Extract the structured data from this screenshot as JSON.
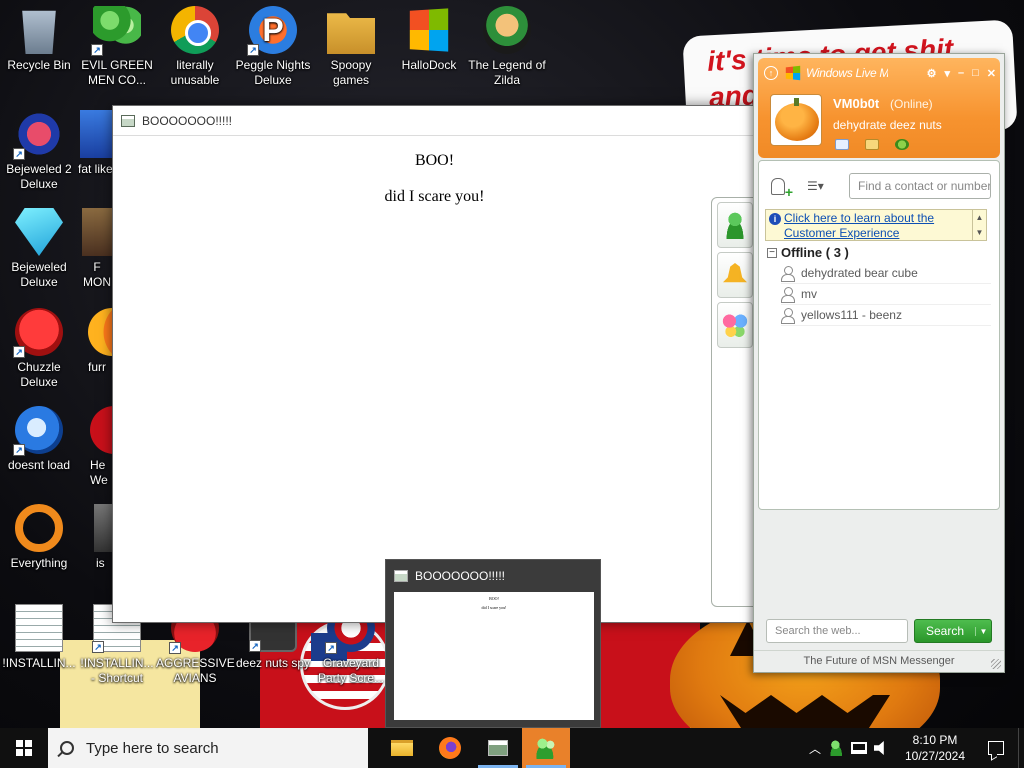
{
  "wallpaper": {
    "sign_line1": "it's time to get shit",
    "sign_line2": "and"
  },
  "desktop_icons": [
    {
      "label": "Recycle Bin",
      "icon": "recycle-bin-icon"
    },
    {
      "label": "EVIL GREEN MEN CO...",
      "icon": "msn-messenger-icon"
    },
    {
      "label": "literally unusable",
      "icon": "chrome-icon"
    },
    {
      "label": "Peggle Nights Deluxe",
      "icon": "peggle-icon"
    },
    {
      "label": "Spoopy games",
      "icon": "folder-icon"
    },
    {
      "label": "HalloDock",
      "icon": "windows-logo-icon"
    },
    {
      "label": "The Legend of Zilda",
      "icon": "zilda-icon"
    },
    {
      "label": "Bejeweled 2 Deluxe",
      "icon": "bejeweled2-icon"
    },
    {
      "label": "fat like",
      "icon": "partial-icon"
    },
    {
      "label": "Bejeweled Deluxe",
      "icon": "gem-icon"
    },
    {
      "label": "F MON",
      "icon": "partial-icon"
    },
    {
      "label": "Chuzzle Deluxe",
      "icon": "chuzzle-icon"
    },
    {
      "label": "furr",
      "icon": "firefox-icon"
    },
    {
      "label": "doesnt load",
      "icon": "thunderbird-icon"
    },
    {
      "label": "He We",
      "icon": "partial-icon"
    },
    {
      "label": "Everything",
      "icon": "everything-icon"
    },
    {
      "label": "is",
      "icon": "partial-icon"
    },
    {
      "label": "!INSTALLIN...",
      "icon": "document-icon"
    },
    {
      "label": "!INSTALLIN... - Shortcut",
      "icon": "document-icon"
    },
    {
      "label": "AGGRESSIVE AVIANS",
      "icon": "angry-birds-icon"
    },
    {
      "label": "deez nuts spy",
      "icon": "app-icon"
    },
    {
      "label": "Graveyard Party Scre...",
      "icon": "graveyard-icon"
    }
  ],
  "boo_window": {
    "title": "BOOOOOOO!!!!!",
    "line1": "BOO!",
    "line2": "did I scare you!"
  },
  "thumbnail": {
    "title": "BOOOOOOO!!!!!",
    "line1": "BOO!",
    "line2": "did I scare you!"
  },
  "msn": {
    "brand": "Windows Live Messenger",
    "user_name": "VM0b0t",
    "status": "(Online)",
    "personal_message": "dehydrate deez nuts",
    "find_placeholder": "Find a contact or number...",
    "ad_text": "Click here to learn about the Customer Experience",
    "group_label": "Offline ( 3 )",
    "contacts": [
      "dehydrated bear cube",
      "mv",
      "yellows111 - beenz"
    ],
    "web_search_placeholder": "Search the web...",
    "search_button": "Search",
    "footer": "The Future of MSN Messenger"
  },
  "taskbar": {
    "search_placeholder": "Type here to search",
    "time": "8:10 PM",
    "date": "10/27/2024",
    "apps": [
      "file-explorer-icon",
      "firefox-icon",
      "boo-app-icon",
      "msn-messenger-icon"
    ]
  }
}
